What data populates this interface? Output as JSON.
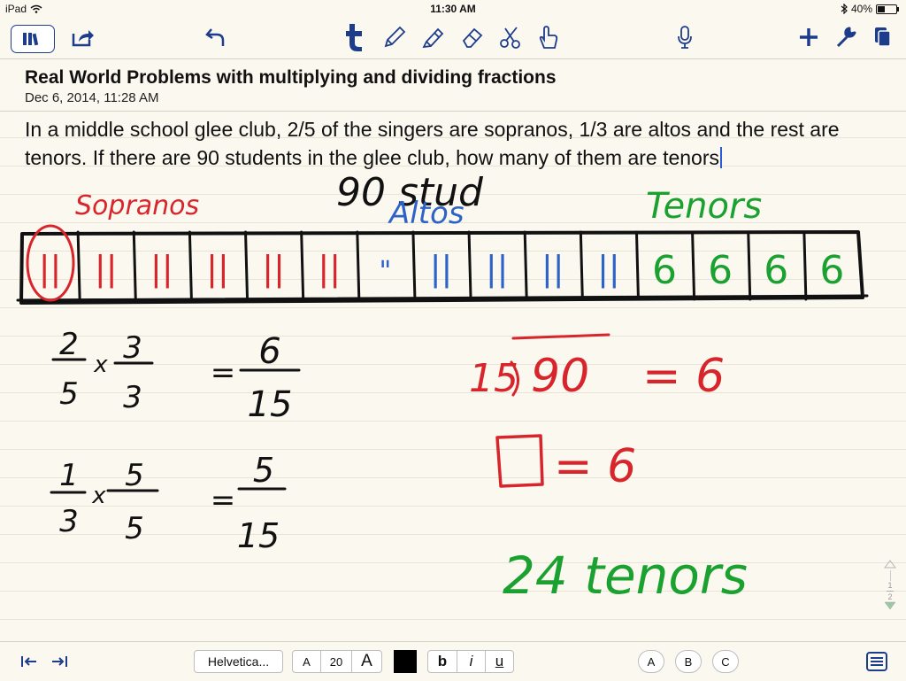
{
  "status": {
    "device": "iPad",
    "time": "11:30 AM",
    "battery": "40%",
    "battery_level": 0.4
  },
  "toolbar": {
    "icons": [
      "library-icon",
      "share-icon",
      "undo-icon",
      "text-tool-icon",
      "pen-icon",
      "highlighter-icon",
      "eraser-icon",
      "scissors-icon",
      "hand-icon",
      "microphone-icon",
      "add-icon",
      "wrench-icon",
      "pages-icon"
    ]
  },
  "note": {
    "title": "Real World Problems with multiplying and dividing fractions",
    "date": "Dec 6, 2014, 11:28 AM",
    "text": "In a middle school glee club, 2/5 of the singers are sopranos, 1/3 are altos and the rest are tenors.  If there are 90 students in the glee club, how many of them are tenors"
  },
  "ink": {
    "colors": {
      "red": "#d8252c",
      "blue": "#2d63c8",
      "green": "#1aa12f",
      "black": "#111111"
    },
    "labels": {
      "sopranos": "Sopranos",
      "altos": "Altos",
      "tenors": "Tenors",
      "students": "90 stud"
    },
    "tape_cells": [
      "||",
      "||",
      "||",
      "||",
      "||",
      "||",
      "\"",
      "||",
      "||",
      "||",
      "||",
      "6",
      "6",
      "6",
      "6"
    ],
    "math": {
      "f1_top": "2",
      "f1_bot": "5",
      "f1_x": "x",
      "f1_mtop": "3",
      "f1_mbot": "3",
      "f1_eq": "=",
      "f1_rtop": "6",
      "f1_rbot": "15",
      "f2_top": "1",
      "f2_bot": "3",
      "f2_x": "x",
      "f2_mtop": "5",
      "f2_mbot": "5",
      "f2_eq": "=",
      "f2_rtop": "5",
      "f2_rbot": "15",
      "div_divisor": "15",
      "div_dividend": "90",
      "div_eq": "= 6",
      "box_eq": "= 6",
      "answer": "24 tenors"
    }
  },
  "pager": {
    "current": "1",
    "total": "2"
  },
  "bottom": {
    "font": "Helvetica...",
    "size_small": "A",
    "size": "20",
    "size_large": "A",
    "color": "#000000",
    "bold": "b",
    "italic": "i",
    "underline": "u",
    "style_a": "A",
    "style_b": "B",
    "style_c": "C"
  }
}
